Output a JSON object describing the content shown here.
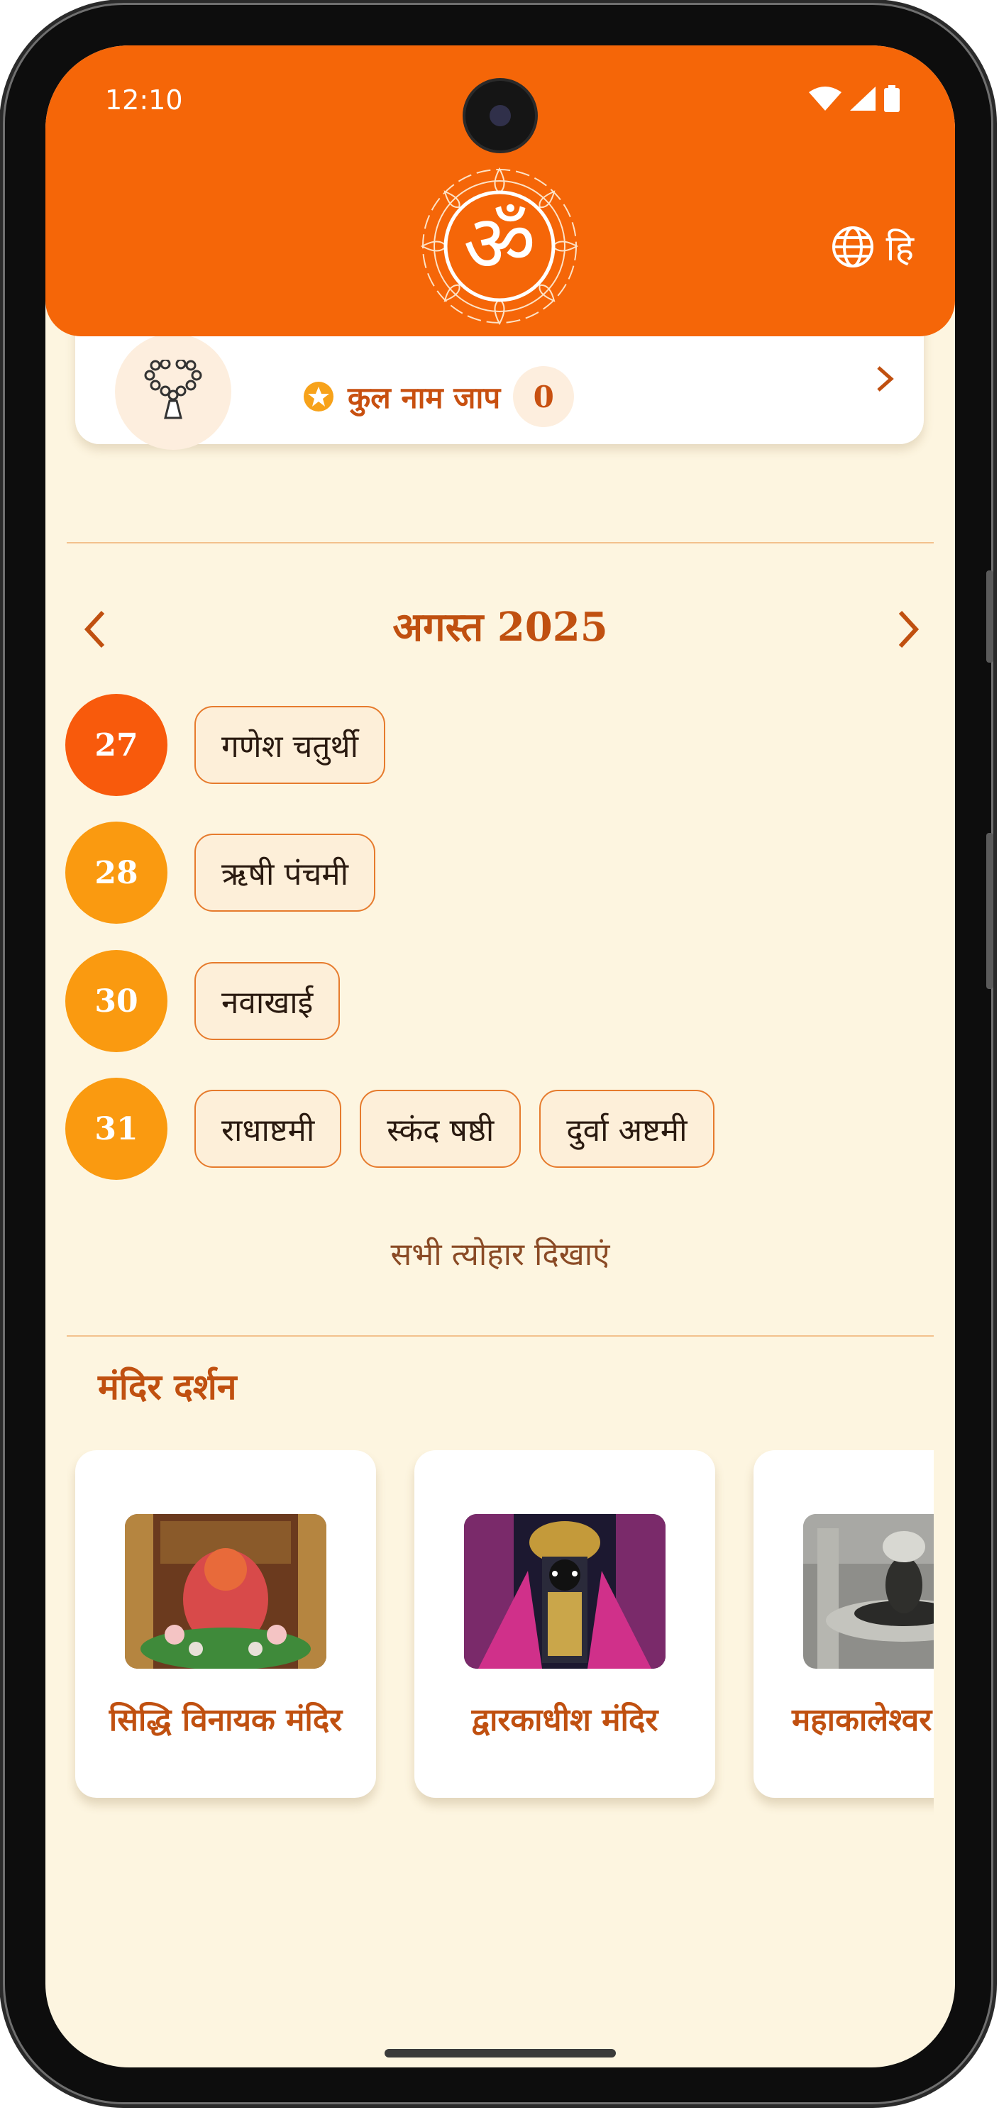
{
  "status_bar": {
    "time": "12:10"
  },
  "header": {
    "language_label": "हि",
    "colors": {
      "header_bg": "#f56608"
    }
  },
  "jaap_card": {
    "total_label": "कुल नाम जाप",
    "total_count": "0"
  },
  "calendar": {
    "month_label": "अगस्त 2025",
    "rows": [
      {
        "day": "27",
        "color": "#f85a0c",
        "festivals": [
          "गणेश चतुर्थी"
        ]
      },
      {
        "day": "28",
        "color": "#fa9a10",
        "festivals": [
          "ऋषी पंचमी"
        ]
      },
      {
        "day": "30",
        "color": "#fa9a10",
        "festivals": [
          "नवाखाई"
        ]
      },
      {
        "day": "31",
        "color": "#fa9a10",
        "festivals": [
          "राधाष्टमी",
          "स्कंद षष्ठी",
          "दुर्वा अष्टमी"
        ]
      }
    ],
    "show_all_label": "सभी त्योहार दिखाएं"
  },
  "temples": {
    "title": "मंदिर दर्शन",
    "items": [
      {
        "name": "सिद्धि विनायक मंदिर",
        "image": "siddhivinayak-photo"
      },
      {
        "name": "द्वारकाधीश मंदिर",
        "image": "dwarkadhish-photo"
      },
      {
        "name": "महाकालेश्वर",
        "image": "mahakaleshwar-photo"
      }
    ]
  }
}
